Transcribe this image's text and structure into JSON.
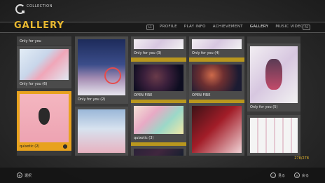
{
  "header": {
    "breadcrumb": "COLLECTION",
    "title": "GALLERY",
    "shoulder_left": "L1",
    "shoulder_right": "R1",
    "tabs": [
      {
        "label": "PROFILE",
        "active": false
      },
      {
        "label": "PLAY INFO",
        "active": false
      },
      {
        "label": "ACHIEVEMENT",
        "active": false
      },
      {
        "label": "GALLERY",
        "active": true
      },
      {
        "label": "MUSIC VIDEO",
        "active": false
      }
    ]
  },
  "gallery": {
    "col1": [
      "Only for you",
      "Only for you (6)",
      "quixotic (2)"
    ],
    "col2": [
      "Only for you (2)"
    ],
    "col3": [
      "Only for you (3)",
      "OPEN FIRE",
      "quixotic (3)"
    ],
    "col4": [
      "Only for you (4)",
      "OPEN FIRE"
    ],
    "col5": [
      "Only for you (5)"
    ],
    "selected": "quixotic (2)"
  },
  "counter": "278/278",
  "footer": {
    "select_label": "選択",
    "view_label": "見る",
    "close_label": "戻る"
  },
  "colors": {
    "accent": "#e8b830",
    "selected": "#e8a21e"
  }
}
